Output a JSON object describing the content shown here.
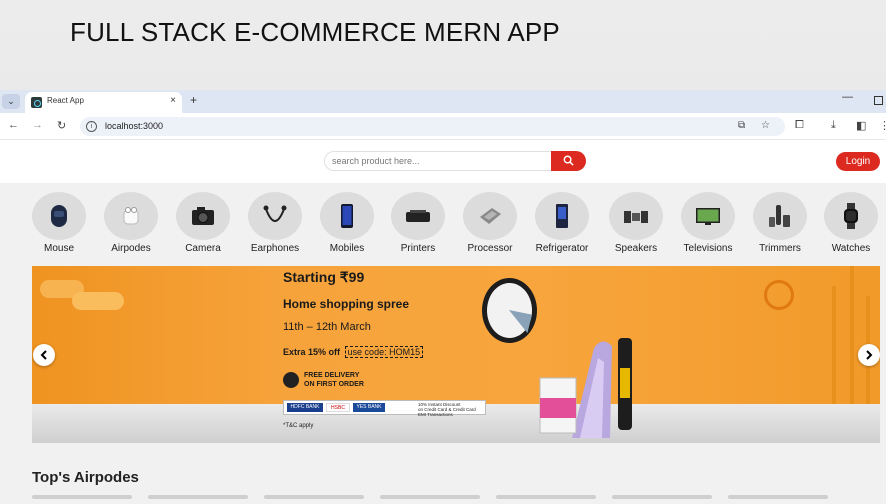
{
  "slide": {
    "title": "FULL STACK E-COMMERCE MERN APP"
  },
  "browser": {
    "tab_title": "React App",
    "tab_close": "×",
    "new_tab": "+",
    "url": "localhost:3000",
    "minimize": "—"
  },
  "header": {
    "search_placeholder": "search product here...",
    "login_label": "Login"
  },
  "categories": [
    {
      "label": "Mouse",
      "icon": "mouse-icon"
    },
    {
      "label": "Airpodes",
      "icon": "airpods-icon"
    },
    {
      "label": "Camera",
      "icon": "camera-icon"
    },
    {
      "label": "Earphones",
      "icon": "earphones-icon"
    },
    {
      "label": "Mobiles",
      "icon": "mobile-icon"
    },
    {
      "label": "Printers",
      "icon": "printer-icon"
    },
    {
      "label": "Processor",
      "icon": "processor-icon"
    },
    {
      "label": "Refrigerator",
      "icon": "refrigerator-icon"
    },
    {
      "label": "Speakers",
      "icon": "speaker-icon"
    },
    {
      "label": "Televisions",
      "icon": "television-icon"
    },
    {
      "label": "Trimmers",
      "icon": "trimmer-icon"
    },
    {
      "label": "Watches",
      "icon": "watch-icon"
    }
  ],
  "banner": {
    "starting": "Starting ₹99",
    "headline": "Home shopping spree",
    "dates": "11th – 12th March",
    "offer_text": "Extra 15% off",
    "offer_code": "use code: HOM15",
    "delivery_line1": "FREE DELIVERY",
    "delivery_line2": "ON FIRST ORDER",
    "bank_hdfc": "HDFC BANK",
    "bank_hsbc": "HSBC",
    "bank_yes": "YES BANK",
    "bank_discount_1": "10% Instant Discount",
    "bank_discount_2": "on Credit Card & Credit Card EMI Transactions",
    "tc": "*T&C apply"
  },
  "sections": {
    "top_airpodes": "Top's Airpodes"
  },
  "colors": {
    "accent": "#dc2a20",
    "banner_orange": "#f6a33b"
  }
}
